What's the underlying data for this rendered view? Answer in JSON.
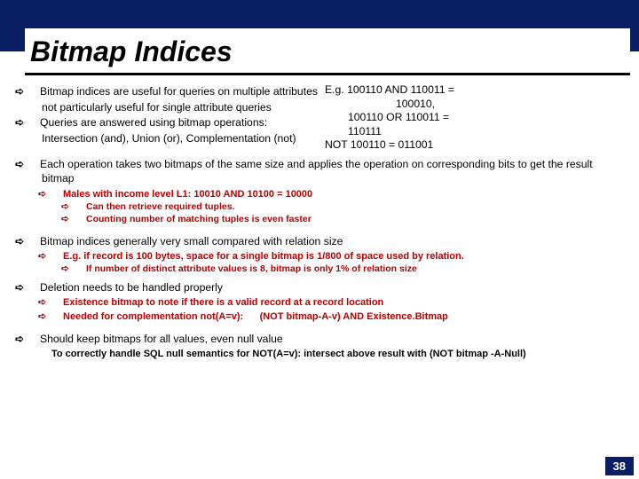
{
  "title": "Bitmap Indices",
  "overlay": {
    "l1a": "E.g. 100110  AND 110011 =",
    "l1b": "100010,",
    "l2a": "100110  OR  110011 =",
    "l2b": "110111",
    "l3": "NOT 100110  = 011001"
  },
  "bullets": {
    "p1": "Bitmap indices are useful for queries on multiple attributes",
    "p1b": "not particularly useful for single attribute queries",
    "p2": "Queries are answered using bitmap operations:",
    "p2b": "Intersection (and), Union (or), Complementation (not)",
    "p3": "Each operation takes two bitmaps of the same size and applies the operation on corresponding bits to get the result bitmap",
    "p3s1": "Males with income level L1:   10010 AND 10100 = 10000",
    "p3s1a": "Can then retrieve required tuples.",
    "p3s1b": "Counting number of matching tuples is even faster",
    "p4": "Bitmap indices generally very small compared with relation size",
    "p4s1": "E.g. if record is 100 bytes, space for a single bitmap is 1/800 of space used by relation.",
    "p4s1a": "If number of distinct attribute values is 8, bitmap is only 1% of relation size",
    "p5": "Deletion needs to be handled properly",
    "p5s1": "Existence bitmap to note if there is a valid record at a record location",
    "p5s2a": "Needed for complementation  not(A=v):",
    "p5s2b": "(NOT bitmap-A-v) AND Existence.Bitmap",
    "p6": "Should keep bitmaps for all values, even null value",
    "p6s1": "To correctly handle SQL null semantics for  NOT(A=v):   intersect above result with  (NOT bitmap -A-Null)"
  },
  "page_number": "38"
}
